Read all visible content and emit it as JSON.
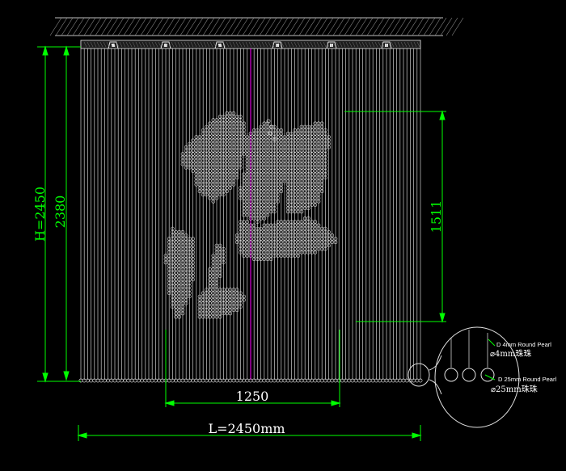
{
  "drawing": {
    "dimensions": {
      "total_height": "H=2450",
      "inner_height": "2380",
      "motif_height": "1511",
      "motif_width": "1250",
      "total_length": "L=2450mm"
    },
    "detail_callout": {
      "small_pearl_en": "D 4mm Round Pearl",
      "small_pearl_cn": "⌀4mm珠珠",
      "large_pearl_en": "D 25mm Round Pearl",
      "large_pearl_cn": "⌀25mm珠珠"
    },
    "colors": {
      "background": "#000000",
      "dimension": "#00ff00",
      "strand": "#d0d0d0",
      "text_white": "#ffffff",
      "center_line": "#ff00ff"
    },
    "hangers": {
      "count": 6
    }
  }
}
